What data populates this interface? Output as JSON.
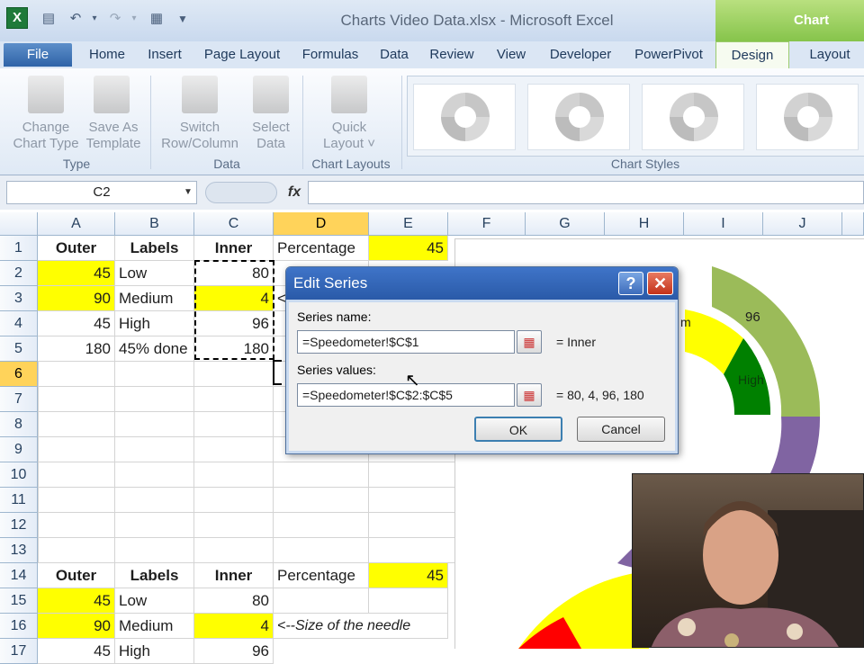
{
  "window": {
    "title": "Charts Video Data.xlsx - Microsoft Excel",
    "contextual_tab": "Chart Tools"
  },
  "quick_access": {
    "excel_icon": "X",
    "save_icon": "save-icon",
    "undo_icon": "undo-icon",
    "redo_icon": "redo-icon"
  },
  "tabs": [
    "File",
    "Home",
    "Insert",
    "Page Layout",
    "Formulas",
    "Data",
    "Review",
    "View",
    "Developer",
    "PowerPivot",
    "Design",
    "Layout"
  ],
  "ribbon": {
    "type_group": {
      "label": "Type",
      "change_chart_type": [
        "Change",
        "Chart Type"
      ],
      "save_as_template": [
        "Save As",
        "Template"
      ]
    },
    "data_group": {
      "label": "Data",
      "switch_row_column": [
        "Switch",
        "Row/Column"
      ],
      "select_data": [
        "Select",
        "Data"
      ]
    },
    "chart_layouts_group": {
      "label": "Chart Layouts",
      "quick_layout": [
        "Quick",
        "Layout ˅"
      ]
    },
    "chart_styles_group": {
      "label": "Chart Styles"
    }
  },
  "formula_bar": {
    "name_box": "C2",
    "fx": "fx",
    "formula": ""
  },
  "columns": [
    "A",
    "B",
    "C",
    "D",
    "E",
    "F",
    "G",
    "H",
    "I",
    "J"
  ],
  "rows": [
    "1",
    "2",
    "3",
    "4",
    "5",
    "6",
    "7",
    "8",
    "9",
    "10",
    "11",
    "12",
    "13",
    "14",
    "15",
    "16",
    "17"
  ],
  "table_top": {
    "headers": {
      "outer": "Outer",
      "labels": "Labels",
      "inner": "Inner",
      "percentage": "Percentage",
      "percentage_value": "45"
    },
    "rows": [
      {
        "outer": "45",
        "label": "Low",
        "inner": "80"
      },
      {
        "outer": "90",
        "label": "Medium",
        "inner": "4"
      },
      {
        "outer": "45",
        "label": "High",
        "inner": "96"
      },
      {
        "outer": "180",
        "label": "45% done",
        "inner": "180"
      }
    ],
    "needle_note_partial": "<-"
  },
  "table_bottom": {
    "headers": {
      "outer": "Outer",
      "labels": "Labels",
      "inner": "Inner",
      "percentage": "Percentage",
      "percentage_value": "45"
    },
    "rows": [
      {
        "outer": "45",
        "label": "Low",
        "inner": "80"
      },
      {
        "outer": "90",
        "label": "Medium",
        "inner": "4",
        "note": "<--Size of the needle"
      },
      {
        "outer": "45",
        "label": "High",
        "inner": "96"
      }
    ]
  },
  "chart": {
    "labels": {
      "medium_partial": "m",
      "value_96": "96",
      "high": "High"
    }
  },
  "dialog": {
    "title": "Edit Series",
    "help": "?",
    "close": "✕",
    "series_name_label": "Series name:",
    "series_name_value": "=Speedometer!$C$1",
    "series_name_result": "= Inner",
    "series_values_label": "Series values:",
    "series_values_value": "=Speedometer!$C$2:$C$5",
    "series_values_result": "= 80, 4, 96, 180",
    "ok": "OK",
    "cancel": "Cancel"
  },
  "colors": {
    "highlight": "#ffff00",
    "chart_green": "#008000",
    "chart_lightgreen": "#9bbb59",
    "chart_purple": "#8064a2",
    "chart_red": "#ff0000"
  }
}
